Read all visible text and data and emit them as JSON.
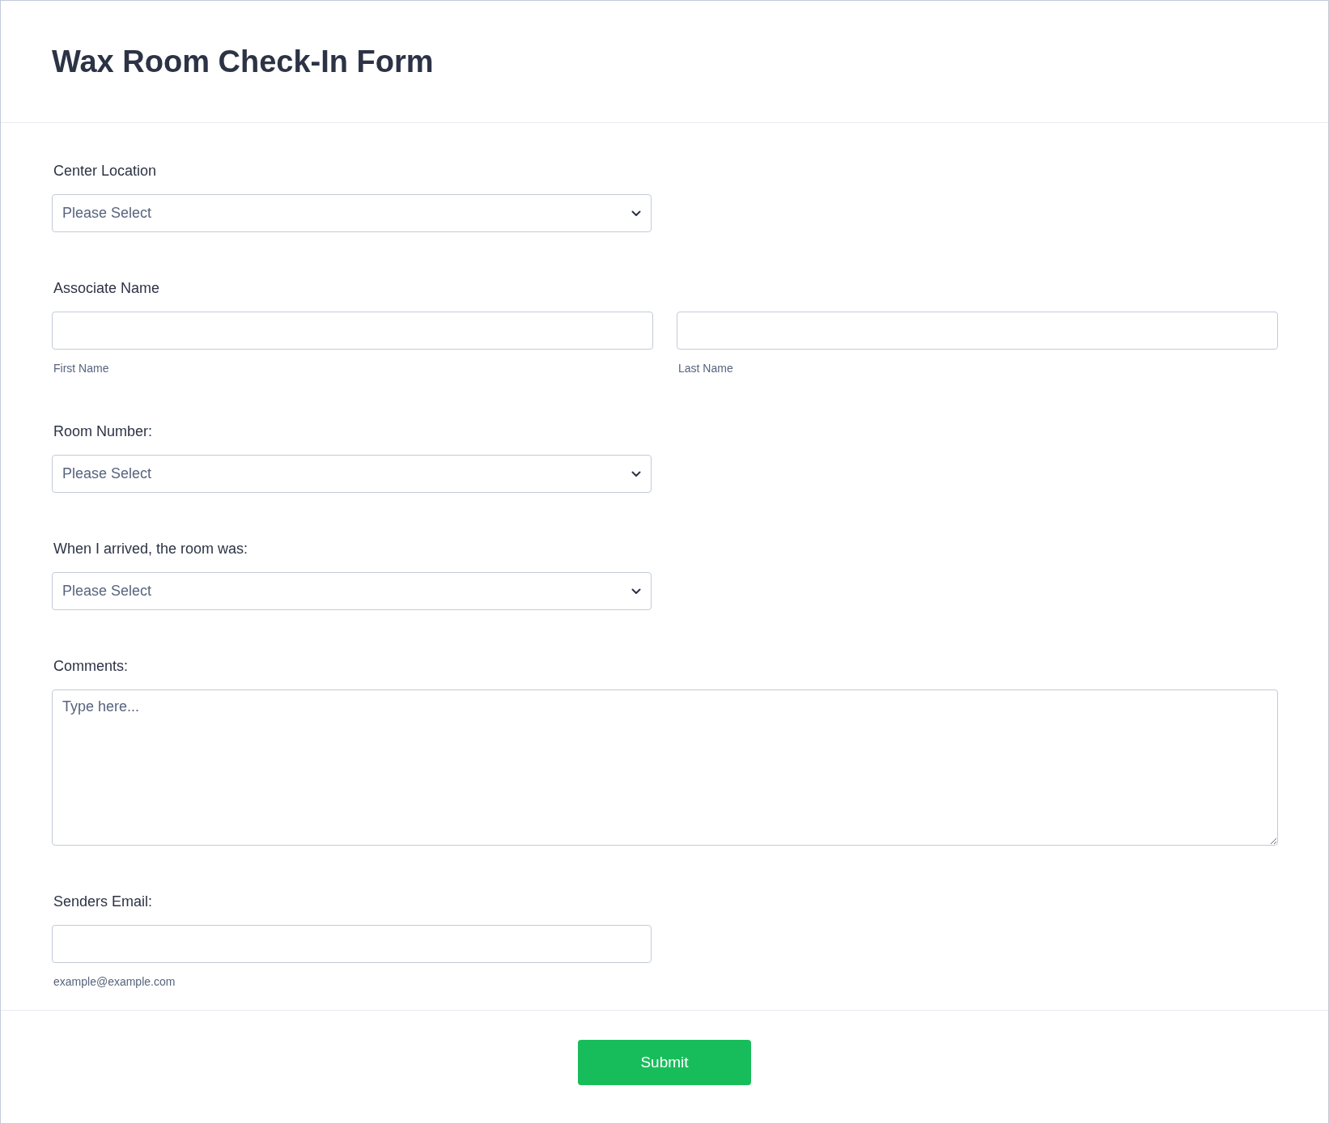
{
  "form": {
    "title": "Wax Room Check-In Form"
  },
  "questions": [
    {
      "kind": "select",
      "label": "Center Location",
      "placeholder": "Please Select"
    },
    {
      "kind": "name",
      "label": "Associate Name",
      "sublabels": [
        "First Name",
        "Last Name"
      ]
    },
    {
      "kind": "select",
      "label": "Room Number:",
      "placeholder": "Please Select"
    },
    {
      "kind": "select",
      "label": "When I arrived, the room was:",
      "placeholder": "Please Select"
    },
    {
      "kind": "textarea",
      "label": "Comments:",
      "placeholder": "Type here..."
    },
    {
      "kind": "email",
      "label": "Senders Email:",
      "sublabel": "example@example.com"
    }
  ],
  "submit": {
    "label": "Submit"
  }
}
